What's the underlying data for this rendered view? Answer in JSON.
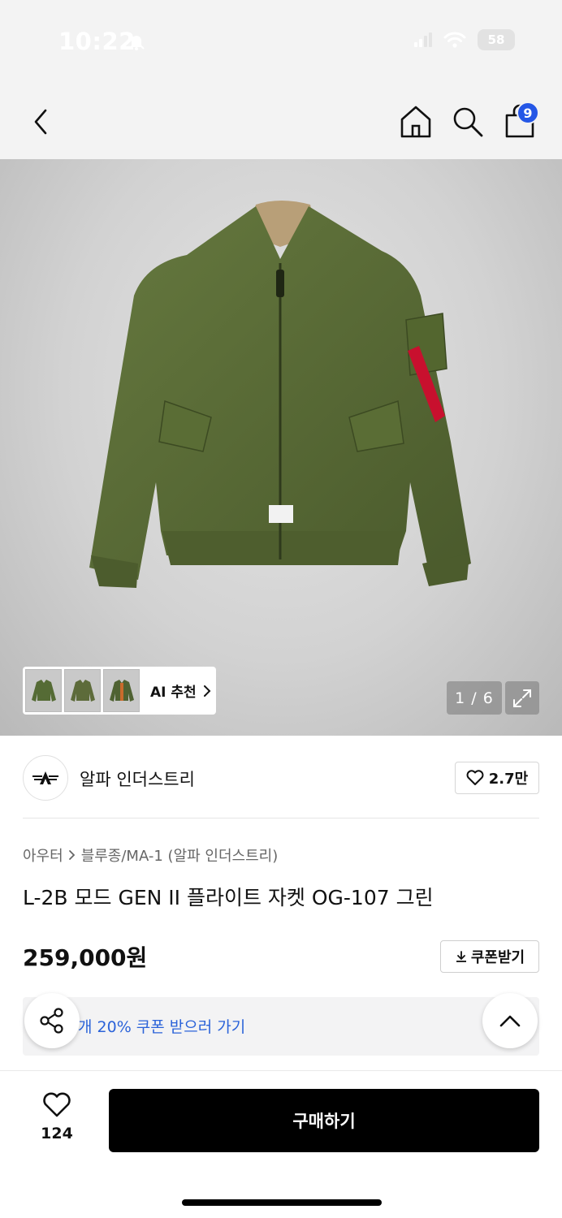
{
  "status_bar": {
    "time": "10:22",
    "battery": "58"
  },
  "header": {
    "cart_count": "9"
  },
  "gallery": {
    "ai_label": "AI 추천",
    "pager": "1 / 6"
  },
  "brand": {
    "name": "알파 인더스트리",
    "likes": "2.7만"
  },
  "product": {
    "breadcrumb_category": "아우터",
    "breadcrumb_subcategory": "블루종/MA-1 (알파 인더스트리)",
    "title": "L-2B 모드 GEN II 플라이트 자켓 OG-107 그린",
    "price": "259,000원",
    "coupon_button": "쿠폰받기",
    "coupon_banner": "개 20% 쿠폰 받으러 가기"
  },
  "bottom_bar": {
    "wish_count": "124",
    "buy_label": "구매하기"
  },
  "colors": {
    "accent_blue": "#2557e6",
    "coupon_text": "#2b63d9",
    "buy_button": "#000000",
    "jacket": "#556b35"
  }
}
